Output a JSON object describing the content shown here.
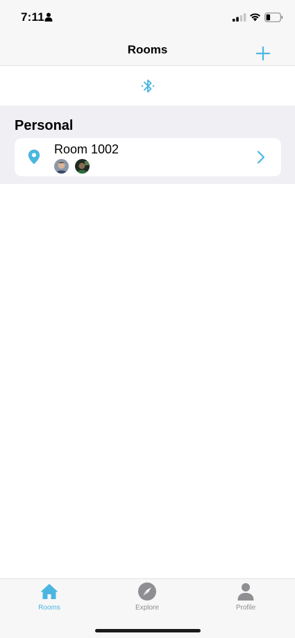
{
  "status_bar": {
    "time": "7:11"
  },
  "nav": {
    "title": "Rooms",
    "add_icon": "plus-icon"
  },
  "bluetooth": {
    "icon": "bluetooth-icon"
  },
  "section": {
    "title": "Personal",
    "rooms": [
      {
        "name": "Room 1002",
        "icon": "location-pin-icon",
        "avatars": [
          "avatar-1",
          "avatar-2"
        ]
      }
    ]
  },
  "tab_bar": {
    "tabs": [
      {
        "label": "Rooms",
        "icon": "home-icon",
        "active": true
      },
      {
        "label": "Explore",
        "icon": "compass-icon",
        "active": false
      },
      {
        "label": "Profile",
        "icon": "person-icon",
        "active": false
      }
    ]
  },
  "colors": {
    "accent": "#4ab6e0",
    "inactive": "#8e8e93",
    "section_bg": "#efeff4",
    "bar_bg": "#f7f7f7"
  }
}
